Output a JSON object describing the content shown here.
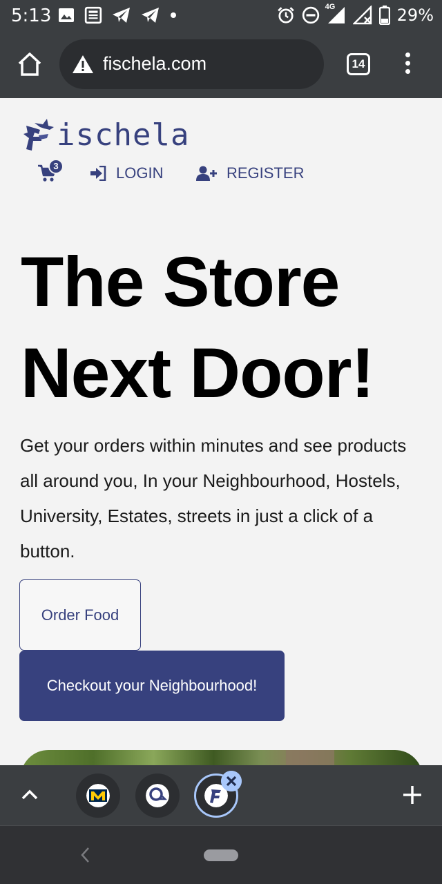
{
  "status_bar": {
    "time": "5:13",
    "network": "4G",
    "battery": "29%"
  },
  "browser": {
    "url": "fischela.com",
    "tab_count": "14"
  },
  "site": {
    "logo_text": "ischela",
    "cart_count": "3",
    "nav": {
      "login": "LOGIN",
      "register": "REGISTER"
    },
    "hero": {
      "title_line1": "The Store",
      "title_line2": "Next Door!",
      "description": "Get your orders within minutes and see products all around you, In your Neighbourhood, Hostels, University, Estates, streets in just a click of a button."
    },
    "buttons": {
      "order_food": "Order Food",
      "checkout": "Checkout your Neighbourhood!"
    }
  },
  "colors": {
    "brand": "#37417e",
    "chrome_dark": "#3b3e41",
    "page_bg": "#f3f3f3",
    "active_tab_ring": "#a8c7fa"
  },
  "tab_strip": {
    "tabs": [
      {
        "icon": "michigan-m-favicon"
      },
      {
        "icon": "o2-favicon"
      },
      {
        "icon": "fischela-favicon",
        "active": true
      }
    ]
  }
}
